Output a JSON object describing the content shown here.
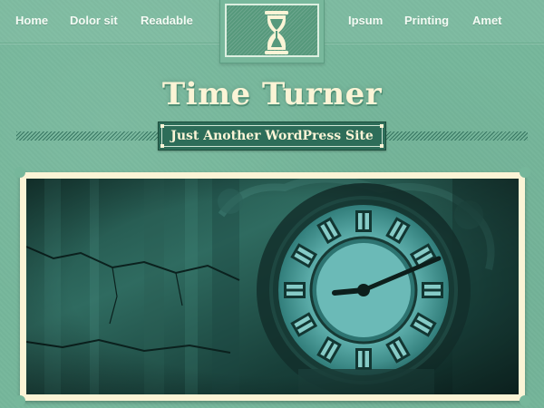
{
  "nav": {
    "items": [
      {
        "label": "Home"
      },
      {
        "label": "Dolor sit"
      },
      {
        "label": "Readable"
      },
      {
        "label": "Ipsum"
      },
      {
        "label": "Printing"
      },
      {
        "label": "Amet"
      }
    ]
  },
  "logo": {
    "icon": "hourglass-icon"
  },
  "site": {
    "title": "Time Turner",
    "tagline": "Just Another WordPress Site"
  },
  "header_image": {
    "subject": "clock-face-icon"
  },
  "colors": {
    "background": "#76b79b",
    "title": "#fbf4d6",
    "tagline_bg": "#2d6d59",
    "frame": "#fbf4d6"
  }
}
